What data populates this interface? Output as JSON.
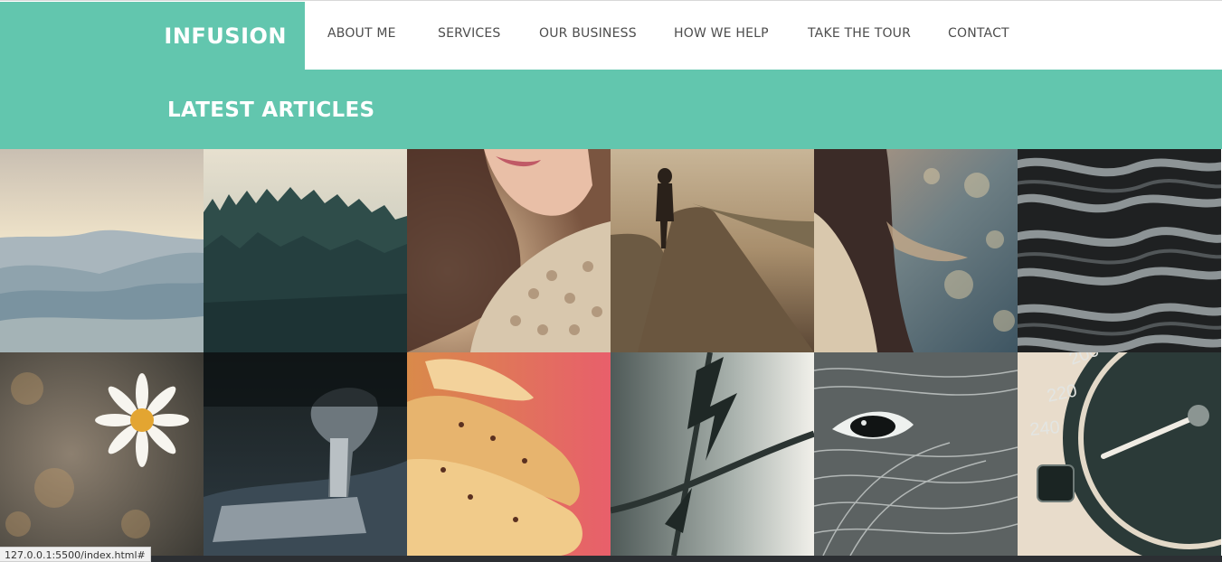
{
  "brand": {
    "name": "INFUSION"
  },
  "nav": [
    {
      "label": "ABOUT ME"
    },
    {
      "label": "SERVICES"
    },
    {
      "label": "OUR BUSINESS"
    },
    {
      "label": "HOW WE HELP"
    },
    {
      "label": "TAKE THE TOUR"
    },
    {
      "label": "CONTACT"
    }
  ],
  "banner": {
    "title": "LATEST ARTICLES"
  },
  "articles": [
    {
      "image": "misty-mountains"
    },
    {
      "image": "pine-forest"
    },
    {
      "image": "woman-knit-sweater"
    },
    {
      "image": "person-on-foggy-road"
    },
    {
      "image": "woman-hair-bokeh"
    },
    {
      "image": "twisted-rope"
    },
    {
      "image": "daisy-flower"
    },
    {
      "image": "car-gear-shift"
    },
    {
      "image": "fried-food-closeup"
    },
    {
      "image": "barbed-wire"
    },
    {
      "image": "eagle-eye-feathers"
    },
    {
      "image": "speedometer"
    }
  ],
  "speedometer": {
    "labels": [
      "200",
      "220",
      "240"
    ]
  },
  "status_bar": {
    "url": "127.0.0.1:5500/index.html#"
  },
  "colors": {
    "accent": "#62c6ae",
    "nav_text": "#4d4d4d",
    "status_bg": "#f0f0f0"
  }
}
